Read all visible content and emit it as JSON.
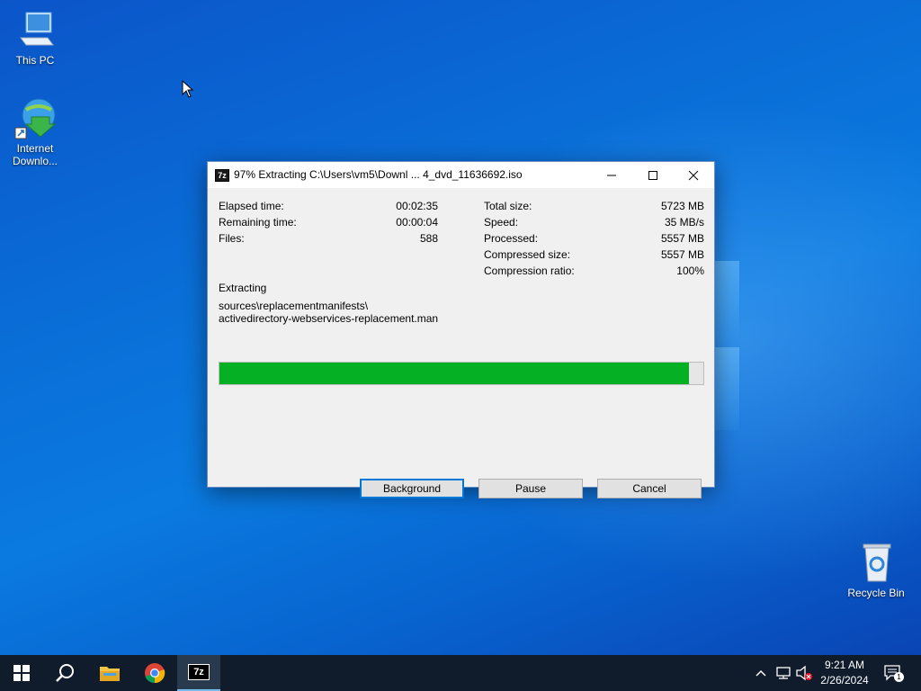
{
  "desktop": {
    "icons": [
      {
        "label": "This PC"
      },
      {
        "label": "Internet Downlo..."
      },
      {
        "label": "Recycle Bin"
      }
    ]
  },
  "dialog": {
    "app_icon_text": "7z",
    "title": "97% Extracting C:\\Users\\vm5\\Downl ... 4_dvd_11636692.iso",
    "stats_left": [
      {
        "label": "Elapsed time:",
        "value": "00:02:35"
      },
      {
        "label": "Remaining time:",
        "value": "00:00:04"
      },
      {
        "label": "Files:",
        "value": "588"
      }
    ],
    "stats_right": [
      {
        "label": "Total size:",
        "value": "5723 MB"
      },
      {
        "label": "Speed:",
        "value": "35 MB/s"
      },
      {
        "label": "Processed:",
        "value": "5557 MB"
      },
      {
        "label": "Compressed size:",
        "value": "5557 MB"
      },
      {
        "label": "Compression ratio:",
        "value": "100%"
      }
    ],
    "action_label": "Extracting",
    "current_path_line1": "sources\\replacementmanifests\\",
    "current_path_line2": "activedirectory-webservices-replacement.man",
    "progress_percent": 97,
    "buttons": {
      "background": "Background",
      "pause": "Pause",
      "cancel": "Cancel"
    }
  },
  "taskbar": {
    "items": [
      "start-button",
      "search-icon",
      "file-explorer-icon",
      "chrome-icon",
      "7zip-icon"
    ],
    "clock_time": "9:21 AM",
    "clock_date": "2/26/2024",
    "notification_count": "1"
  },
  "colors": {
    "accent": "#0078d7",
    "progress": "#06b025",
    "taskbar": "#101c2c"
  }
}
